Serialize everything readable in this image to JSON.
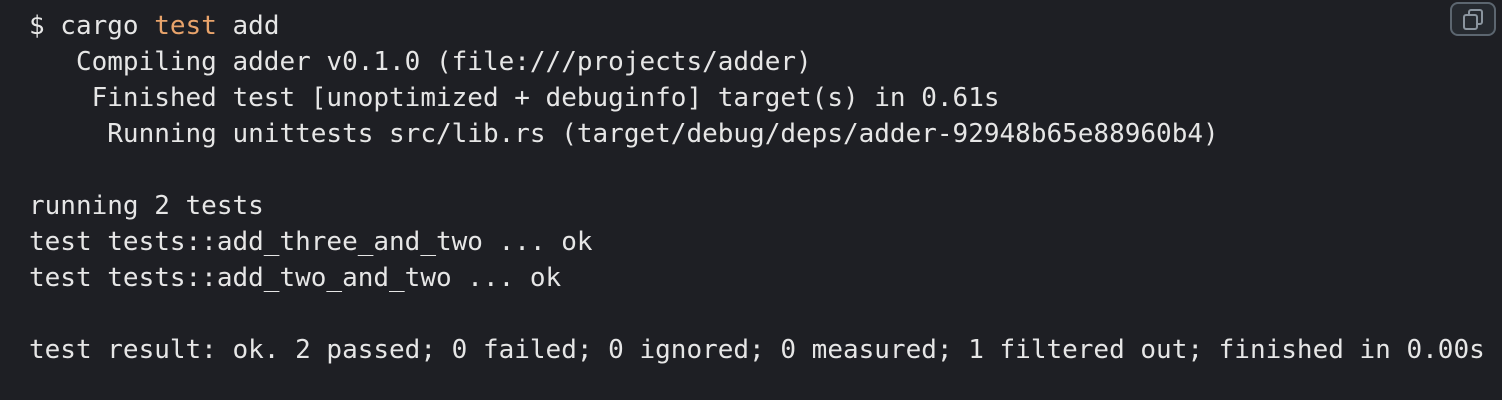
{
  "terminal": {
    "lines": {
      "l1_prompt": "$ cargo ",
      "l1_keyword": "test",
      "l1_arg": " add",
      "l2": "   Compiling adder v0.1.0 (file:///projects/adder)",
      "l3": "    Finished test [unoptimized + debuginfo] target(s) in 0.61s",
      "l4": "     Running unittests src/lib.rs (target/debug/deps/adder-92948b65e88960b4)",
      "l5": "",
      "l6": "running 2 tests",
      "l7": "test tests::add_three_and_two ... ok",
      "l8": "test tests::add_two_and_two ... ok",
      "l9": "",
      "l10": "test result: ok. 2 passed; 0 failed; 0 ignored; 0 measured; 1 filtered out; finished in 0.00s"
    }
  },
  "copy_button": {
    "icon": "copy-icon"
  },
  "colors": {
    "background": "#1e1f24",
    "text": "#e6e6e6",
    "keyword": "#e8a36b"
  }
}
